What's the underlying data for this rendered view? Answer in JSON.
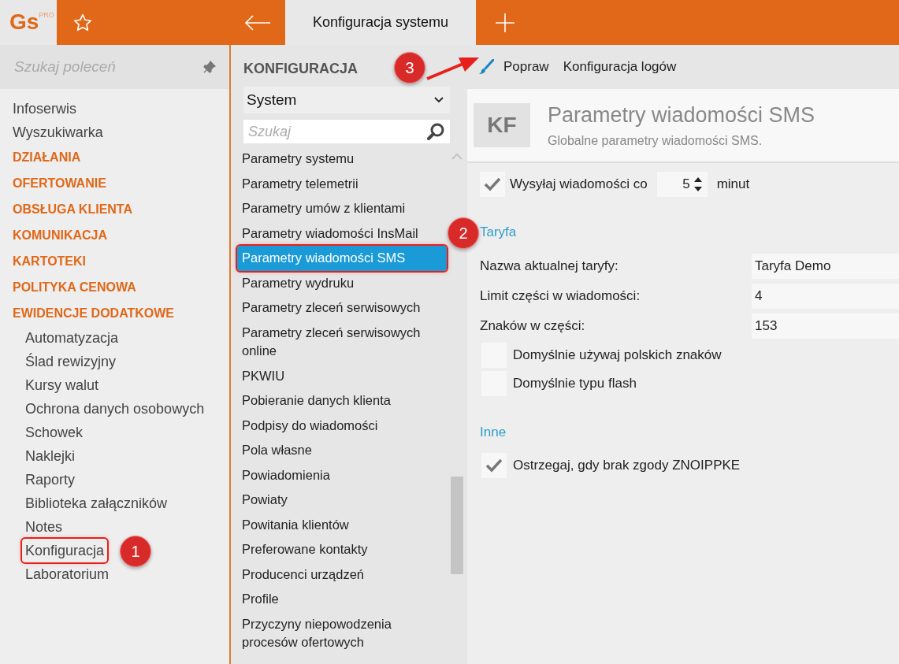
{
  "app": {
    "logo": "Gs",
    "logo_tag": "PRO"
  },
  "tabs": [
    {
      "label": "Konfiguracja systemu",
      "selected": true
    }
  ],
  "sidebar": {
    "search_placeholder": "Szukaj poleceń",
    "items": [
      {
        "label": "Infoserwis",
        "kind": "item",
        "marked": false
      },
      {
        "label": "Wyszukiwarka",
        "kind": "item",
        "marked": false
      },
      {
        "label": "DZIAŁANIA",
        "kind": "category",
        "marked": false
      },
      {
        "label": "OFERTOWANIE",
        "kind": "category",
        "marked": false
      },
      {
        "label": "OBSŁUGA KLIENTA",
        "kind": "category",
        "marked": false
      },
      {
        "label": "KOMUNIKACJA",
        "kind": "category",
        "marked": false
      },
      {
        "label": "KARTOTEKI",
        "kind": "category",
        "marked": false
      },
      {
        "label": "POLITYKA CENOWA",
        "kind": "category",
        "marked": false
      },
      {
        "label": "EWIDENCJE DODATKOWE",
        "kind": "category",
        "marked": false,
        "children": [
          {
            "label": "Automatyzacja",
            "marked": false
          },
          {
            "label": "Ślad rewizyjny",
            "marked": false
          },
          {
            "label": "Kursy walut",
            "marked": false
          },
          {
            "label": "Ochrona danych osobowych",
            "marked": false
          },
          {
            "label": "Schowek",
            "marked": false
          },
          {
            "label": "Naklejki",
            "marked": false
          },
          {
            "label": "Raporty",
            "marked": false
          },
          {
            "label": "Biblioteka załączników",
            "marked": false
          },
          {
            "label": "Notes",
            "marked": false
          },
          {
            "label": "Konfiguracja",
            "marked": true
          },
          {
            "label": "Laboratorium",
            "marked": false
          }
        ]
      }
    ]
  },
  "config": {
    "title": "KONFIGURACJA",
    "module": "System",
    "search_placeholder": "Szukaj",
    "items": [
      {
        "label": "Parametry systemu",
        "selected": false,
        "marked": false
      },
      {
        "label": "Parametry telemetrii",
        "selected": false,
        "marked": false
      },
      {
        "label": "Parametry umów z klientami",
        "selected": false,
        "marked": false
      },
      {
        "label": "Parametry wiadomości InsMail",
        "selected": false,
        "marked": false
      },
      {
        "label": "Parametry wiadomości SMS",
        "selected": true,
        "marked": true
      },
      {
        "label": "Parametry wydruku",
        "selected": false,
        "marked": false
      },
      {
        "label": "Parametry zleceń serwisowych",
        "selected": false,
        "marked": false
      },
      {
        "label": "Parametry zleceń serwisowych online",
        "selected": false,
        "marked": false
      },
      {
        "label": "PKWIU",
        "selected": false,
        "marked": false
      },
      {
        "label": "Pobieranie danych klienta",
        "selected": false,
        "marked": false
      },
      {
        "label": "Podpisy do wiadomości",
        "selected": false,
        "marked": false
      },
      {
        "label": "Pola własne",
        "selected": false,
        "marked": false
      },
      {
        "label": "Powiadomienia",
        "selected": false,
        "marked": false
      },
      {
        "label": "Powiaty",
        "selected": false,
        "marked": false
      },
      {
        "label": "Powitania klientów",
        "selected": false,
        "marked": false
      },
      {
        "label": "Preferowane kontakty",
        "selected": false,
        "marked": false
      },
      {
        "label": "Producenci urządzeń",
        "selected": false,
        "marked": false
      },
      {
        "label": "Profile",
        "selected": false,
        "marked": false
      },
      {
        "label": "Przyczyny niepowodzenia procesów ofertowych",
        "selected": false,
        "marked": false
      }
    ]
  },
  "toolbar": [
    {
      "label": "Popraw",
      "kind": "edit"
    },
    {
      "label": "Konfiguracja logów",
      "kind": "plain"
    }
  ],
  "detail": {
    "badge": "KF",
    "title": "Parametry wiadomości SMS",
    "subtitle": "Globalne parametry wiadomości SMS.",
    "send": {
      "checked": true,
      "label": "Wysyłaj wiadomości co",
      "value": "5",
      "unit": "minut"
    },
    "sections": [
      {
        "title": "Taryfa",
        "rows": [
          {
            "kind": "field",
            "label": "Nazwa aktualnej taryfy:",
            "value": "Taryfa Demo"
          },
          {
            "kind": "field",
            "label": "Limit części w wiadomości:",
            "value": "4"
          },
          {
            "kind": "field",
            "label": "Znaków w części:",
            "value": "153"
          },
          {
            "kind": "checkbox",
            "label": "Domyślnie używaj polskich znaków",
            "checked": false
          },
          {
            "kind": "checkbox",
            "label": "Domyślnie typu flash",
            "checked": false
          }
        ]
      },
      {
        "title": "Inne",
        "rows": [
          {
            "kind": "checkbox",
            "label": "Ostrzegaj, gdy brak zgody ZNOIPPKE",
            "checked": true
          }
        ]
      }
    ]
  },
  "annotations": [
    {
      "number": "1",
      "kind": "callout"
    },
    {
      "number": "2",
      "kind": "callout"
    },
    {
      "number": "3",
      "kind": "arrow-callout"
    }
  ]
}
